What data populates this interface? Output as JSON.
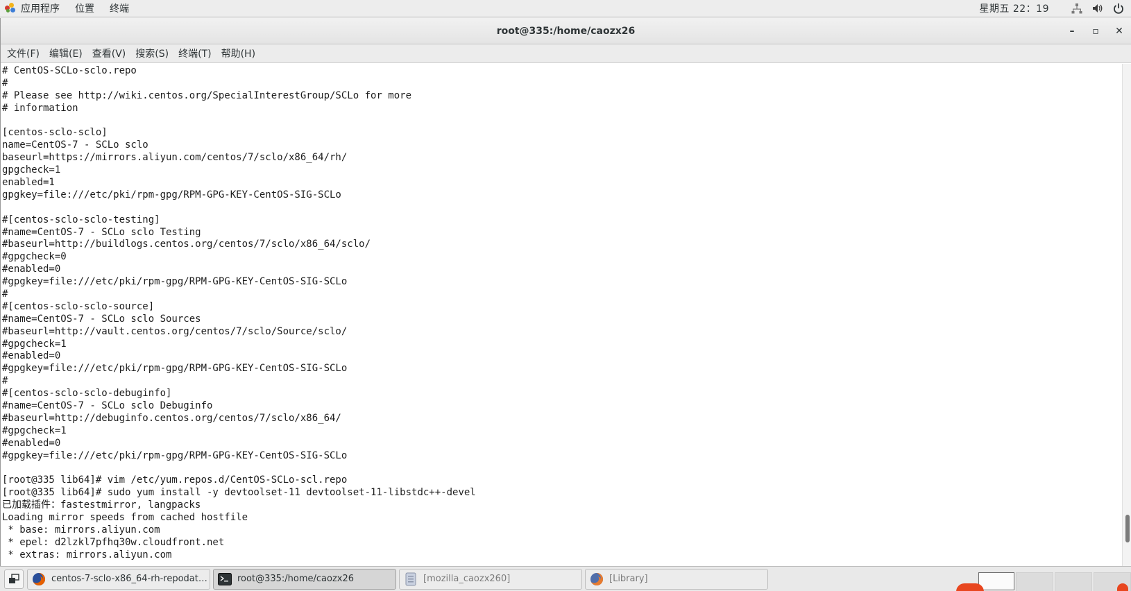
{
  "top_panel": {
    "apps_menu": "应用程序",
    "places_menu": "位置",
    "terminal_menu": "终端",
    "clock": "星期五 22：19"
  },
  "window": {
    "title": "root@335:/home/caozx26",
    "controls": {
      "minimize": "–",
      "maximize": "▫",
      "close": "✕"
    },
    "menubar": [
      "文件(F)",
      "编辑(E)",
      "查看(V)",
      "搜索(S)",
      "终端(T)",
      "帮助(H)"
    ]
  },
  "terminal": {
    "lines": [
      "# CentOS-SCLo-sclo.repo",
      "#",
      "# Please see http://wiki.centos.org/SpecialInterestGroup/SCLo for more",
      "# information",
      "",
      "[centos-sclo-sclo]",
      "name=CentOS-7 - SCLo sclo",
      "baseurl=https://mirrors.aliyun.com/centos/7/sclo/x86_64/rh/",
      "gpgcheck=1",
      "enabled=1",
      "gpgkey=file:///etc/pki/rpm-gpg/RPM-GPG-KEY-CentOS-SIG-SCLo",
      "",
      "#[centos-sclo-sclo-testing]",
      "#name=CentOS-7 - SCLo sclo Testing",
      "#baseurl=http://buildlogs.centos.org/centos/7/sclo/x86_64/sclo/",
      "#gpgcheck=0",
      "#enabled=0",
      "#gpgkey=file:///etc/pki/rpm-gpg/RPM-GPG-KEY-CentOS-SIG-SCLo",
      "#",
      "#[centos-sclo-sclo-source]",
      "#name=CentOS-7 - SCLo sclo Sources",
      "#baseurl=http://vault.centos.org/centos/7/sclo/Source/sclo/",
      "#gpgcheck=1",
      "#enabled=0",
      "#gpgkey=file:///etc/pki/rpm-gpg/RPM-GPG-KEY-CentOS-SIG-SCLo",
      "#",
      "#[centos-sclo-sclo-debuginfo]",
      "#name=CentOS-7 - SCLo sclo Debuginfo",
      "#baseurl=http://debuginfo.centos.org/centos/7/sclo/x86_64/",
      "#gpgcheck=1",
      "#enabled=0",
      "#gpgkey=file:///etc/pki/rpm-gpg/RPM-GPG-KEY-CentOS-SIG-SCLo",
      "",
      "[root@335 lib64]# vim /etc/yum.repos.d/CentOS-SCLo-scl.repo",
      "[root@335 lib64]# sudo yum install -y devtoolset-11 devtoolset-11-libstdc++-devel",
      "已加载插件：fastestmirror, langpacks",
      "Loading mirror speeds from cached hostfile",
      " * base: mirrors.aliyun.com",
      " * epel: d2lzkl7pfhq30w.cloudfront.net",
      " * extras: mirrors.aliyun.com"
    ]
  },
  "taskbar": {
    "tasks": [
      {
        "label": "centos-7-sclo-x86_64-rh-repodata...",
        "icon": "firefox-icon",
        "state": "normal"
      },
      {
        "label": "root@335:/home/caozx26",
        "icon": "terminal-icon",
        "state": "active"
      },
      {
        "label": "[mozilla_caozx260]",
        "icon": "folder-icon",
        "state": "minimized"
      },
      {
        "label": "[Library]",
        "icon": "firefox-icon",
        "state": "minimized"
      }
    ]
  },
  "colors": {
    "panel_bg": "#ededed",
    "terminal_bg": "#ffffff",
    "terminal_fg": "#1e1e1e",
    "firefox_orange": "#e66000",
    "firefox_blue": "#2a4f9a"
  }
}
